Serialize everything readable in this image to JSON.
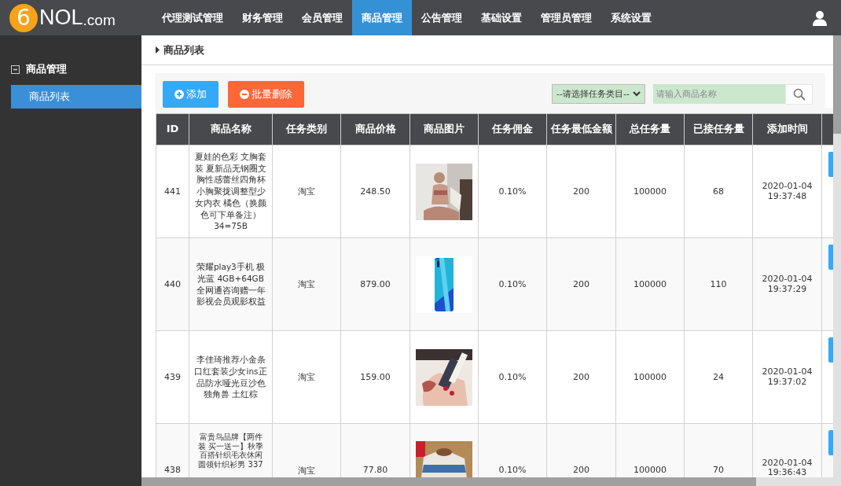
{
  "logo": {
    "mark": "6",
    "name": "NOL",
    "suffix": ".com"
  },
  "nav": [
    {
      "label": "代理测试管理",
      "selected": false
    },
    {
      "label": "财务管理",
      "selected": false
    },
    {
      "label": "会员管理",
      "selected": false
    },
    {
      "label": "商品管理",
      "selected": true
    },
    {
      "label": "公告管理",
      "selected": false
    },
    {
      "label": "基础设置",
      "selected": false
    },
    {
      "label": "管理员管理",
      "selected": false
    },
    {
      "label": "系统设置",
      "selected": false
    }
  ],
  "sidebar": {
    "groups": [
      {
        "label": "商品管理",
        "expanded": true,
        "children": [
          {
            "label": "商品列表",
            "selected": true
          }
        ]
      }
    ]
  },
  "breadcrumb": "商品列表",
  "toolbar": {
    "add_button": "添加",
    "delete_button": "批量删除",
    "category_select": "--请选择任务类目--",
    "search": {
      "placeholder": "请输入商品名称"
    }
  },
  "table": {
    "columns": [
      "ID",
      "商品名称",
      "任务类别",
      "商品价格",
      "商品图片",
      "任务佣金",
      "任务最低金额",
      "总任务量",
      "已接任务量",
      "添加时间"
    ],
    "rows": [
      {
        "id": "441",
        "name": "夏娃的色彩 文胸套装 夏新品无钢圈文胸性感蕾丝四角杯小胸聚拢调整型少女内衣 橘色（换颜色可下单备注）34=75B",
        "type": "淘宝",
        "price": "248.50",
        "commission": "0.10%",
        "min_amount": "200",
        "total": "100000",
        "accepted": "68",
        "time": "2020-01-04 19:37:48"
      },
      {
        "id": "440",
        "name": "荣耀play3手机 极光蓝 4GB+64GB 全网通咨询赠一年影视会员观影权益",
        "type": "淘宝",
        "price": "879.00",
        "commission": "0.10%",
        "min_amount": "200",
        "total": "100000",
        "accepted": "110",
        "time": "2020-01-04 19:37:29"
      },
      {
        "id": "439",
        "name": "李佳琦推荐小金条口红套装少女ins正品防水哑光豆沙色独角兽 土红棕",
        "type": "淘宝",
        "price": "159.00",
        "commission": "0.10%",
        "min_amount": "200",
        "total": "100000",
        "accepted": "24",
        "time": "2020-01-04 19:37:02"
      },
      {
        "id": "438",
        "name": "富贵鸟品牌【两件装 买一送一】秋季百搭针织毛衣休闲圆领针织衫男 337",
        "type": "淘宝",
        "price": "77.80",
        "commission": "0.10%",
        "min_amount": "200",
        "total": "100000",
        "accepted": "70",
        "time": "2020-01-04 19:36:43"
      }
    ]
  }
}
